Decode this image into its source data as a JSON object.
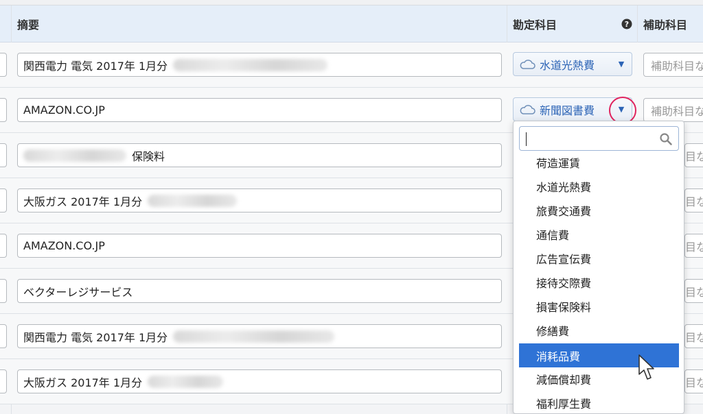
{
  "header": {
    "description": "摘要",
    "account": "勘定科目",
    "sub_account": "補助科目"
  },
  "rows": [
    {
      "description": "関西電力 電気 2017年 1月分",
      "account": "水道光熱費",
      "sub": "補助科目な"
    },
    {
      "description": "AMAZON.CO.JP",
      "account": "新聞図書費",
      "sub": "補助科目な"
    },
    {
      "description": "保険料",
      "sub": "目な"
    },
    {
      "description": "大阪ガス 2017年 1月分",
      "sub": "目な"
    },
    {
      "description": "AMAZON.CO.JP",
      "sub": "目な"
    },
    {
      "description": "ベクターレジサービス",
      "sub": "目な"
    },
    {
      "description": "関西電力 電気 2017年 1月分",
      "sub": "目な"
    },
    {
      "description": "大阪ガス 2017年 1月分",
      "sub": "目な"
    }
  ],
  "dropdown": {
    "search_value": "",
    "items": [
      "荷造運賃",
      "水道光熱費",
      "旅費交通費",
      "通信費",
      "広告宣伝費",
      "接待交際費",
      "損害保険料",
      "修繕費",
      "消耗品費",
      "減価償却費",
      "福利厚生費"
    ],
    "selected": "消耗品費"
  },
  "icons": {
    "help": "help-circle-icon",
    "cloud": "cloud-icon",
    "caret": "caret-down-icon",
    "search": "search-icon",
    "pointer": "mouse-pointer-icon"
  },
  "colors": {
    "accent": "#2c64b6",
    "selected_bg": "#2f73d6",
    "highlight_ring": "#e0245e",
    "header_bg": "#e5eef9"
  }
}
